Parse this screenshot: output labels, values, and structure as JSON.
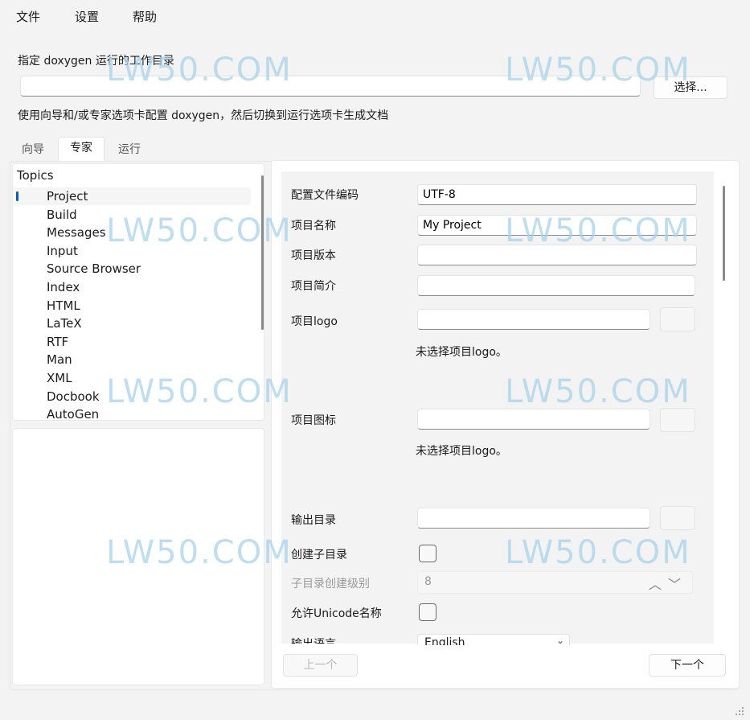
{
  "menu": {
    "file": "文件",
    "settings": "设置",
    "help": "帮助"
  },
  "workdir": {
    "label": "指定 doxygen 运行的工作目录",
    "value": "",
    "browse": "选择..."
  },
  "hint": "使用向导和/或专家选项卡配置 doxygen，然后切换到运行选项卡生成文档",
  "tabs": [
    {
      "label": "向导",
      "active": false
    },
    {
      "label": "专家",
      "active": true
    },
    {
      "label": "运行",
      "active": false
    }
  ],
  "topics": {
    "title": "Topics",
    "selected": "Project",
    "items": [
      "Project",
      "Build",
      "Messages",
      "Input",
      "Source Browser",
      "Index",
      "HTML",
      "LaTeX",
      "RTF",
      "Man",
      "XML",
      "Docbook",
      "AutoGen"
    ]
  },
  "form": {
    "encoding": {
      "label": "配置文件编码",
      "value": "UTF-8"
    },
    "project_name": {
      "label": "项目名称",
      "value": "My Project"
    },
    "project_version": {
      "label": "项目版本",
      "value": ""
    },
    "project_brief": {
      "label": "项目简介",
      "value": ""
    },
    "project_logo": {
      "label": "项目logo",
      "value": "",
      "note": "未选择项目logo。"
    },
    "project_icon": {
      "label": "项目图标",
      "value": "",
      "note": "未选择项目logo。"
    },
    "output_dir": {
      "label": "输出目录",
      "value": ""
    },
    "create_subdirs": {
      "label": "创建子目录",
      "checked": false
    },
    "subdir_levels": {
      "label": "子目录创建级别",
      "value": "8"
    },
    "allow_unicode": {
      "label": "允许Unicode名称",
      "checked": false
    },
    "output_language": {
      "label": "输出语言",
      "value": "English"
    }
  },
  "nav": {
    "prev": "上一个",
    "next": "下一个"
  },
  "watermark": "LW50.COM"
}
